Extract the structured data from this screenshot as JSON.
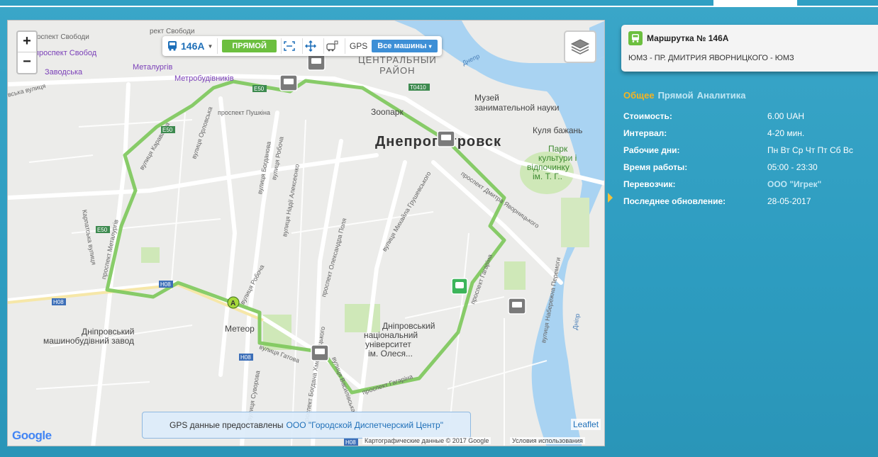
{
  "map": {
    "zoom_in": "+",
    "zoom_out": "−",
    "toolbar": {
      "route": "146A",
      "direction": "ПРЯМОЙ",
      "gps": "GPS",
      "vehicles": "Все машины"
    },
    "city": "Днепропетровск",
    "district_line1": "ЦЕНТРАЛЬНЫЙ",
    "district_line2": "РАЙОН",
    "labels": {
      "svobody1": "проспект Свободи",
      "svobody2": "проспект Свобод",
      "svobody3": "рект Свободи",
      "zavodska": "Заводська",
      "metalurgiv": "Металургів",
      "metrobudivnykiv": "Метробудівників",
      "museum1": "Музей",
      "museum2": "занимательной науки",
      "zoo": "Зоопарк",
      "kulya": "Куля бажань",
      "park1": "Парк",
      "park2": "культури і",
      "park3": "відпочинку",
      "park4": "ім. Т. Г..",
      "dnipro_river": "Днепр",
      "dnipro_river2": "Дніпр",
      "meteor": "Метеор",
      "plant1": "Дніпровський",
      "plant2": "машинобудівний завод",
      "uni1": "Дніпровський",
      "uni2": "національний",
      "uni3": "університет",
      "uni4": "ім. Олеся..."
    },
    "streets": {
      "pushkina": "проспект Пушкіна",
      "orlovska": "вулиця Орловська",
      "karavaeva": "вулиця Караваєва",
      "karpatska": "Карпатська вулиця",
      "metalurgiv_pr": "проспект Металургів",
      "bohdanova": "вулиця Богданова",
      "roboch1": "вулиця Робоча",
      "roboch2": "вулиця Робоча",
      "aleksenko": "вулиця Надії Алексеєнко",
      "polya": "проспект Олександра Поля",
      "hrushevskoho": "вулиця Михайла Грушевського",
      "yavornytskoho": "проспект Дмитра Яворницького",
      "haharina": "проспект Гагаріна",
      "haharina2": "проспект Гагаріна",
      "perevozka": "вулиця Набережна Перемоги",
      "suvorova": "вулиця Суворова",
      "bogdana": "проспект Богдана Хмельницького",
      "hatova": "вулиця Гатова",
      "vasylivska": "вулиця Василівська",
      "zavodska_ul": "вська вулиця"
    },
    "road_badges": {
      "e50a": "E50",
      "e50b": "E50",
      "e50c": "E50",
      "h08a": "H08",
      "h08b": "H08",
      "h08c": "H08",
      "h08d": "H08",
      "t0410": "T0410"
    },
    "marker_a": "A",
    "gps_notice": "GPS данные предоставлены",
    "gps_provider": "ООО \"Городской Диспетчерский Центр\"",
    "google": "Google",
    "leaflet": "Leaflet",
    "map_data": "Картографические данные © 2017 Google",
    "terms": "Условия использования"
  },
  "panel": {
    "route_title": "Маршрутка № 146А",
    "route_subtitle": "ЮМЗ - ПР. ДМИТРИЯ ЯВОРНИЦКОГО - ЮМЗ",
    "tabs": [
      "Общее",
      "Прямой",
      "Аналитика"
    ],
    "info": [
      {
        "key": "Стоимость:",
        "value": "6.00 UAH"
      },
      {
        "key": "Интервал:",
        "value": "4-20 мин."
      },
      {
        "key": "Рабочие дни:",
        "value": "Пн Вт Ср Чт Пт Сб Вс"
      },
      {
        "key": "Время работы:",
        "value": "05:00 - 23:30"
      },
      {
        "key": "Перевозчик:",
        "value": "ООО \"Игрек\""
      },
      {
        "key": "Последнее обновление:",
        "value": "28-05-2017"
      }
    ]
  },
  "colors": {
    "route": "#7cc85a",
    "accent": "#f5b321",
    "background": "#2f9fc3",
    "water": "#a9d3f2"
  }
}
